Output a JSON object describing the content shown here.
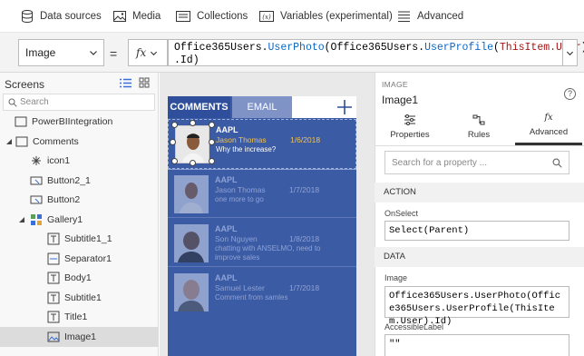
{
  "ribbon": {
    "items": [
      {
        "label": "Data sources",
        "icon": "database-icon"
      },
      {
        "label": "Media",
        "icon": "image-icon"
      },
      {
        "label": "Collections",
        "icon": "collection-icon"
      },
      {
        "label": "Variables (experimental)",
        "icon": "variable-icon"
      },
      {
        "label": "Advanced",
        "icon": "list-icon"
      }
    ]
  },
  "formula_bar": {
    "property": "Image",
    "equals": "=",
    "fx": "fx",
    "tokens": [
      {
        "t": "Office365Users.",
        "c": "plain"
      },
      {
        "t": "UserPhoto",
        "c": "fn"
      },
      {
        "t": "(Office365Users.",
        "c": "plain"
      },
      {
        "t": "UserProfile",
        "c": "fn"
      },
      {
        "t": "(",
        "c": "plain"
      },
      {
        "t": "ThisItem.User",
        "c": "pm"
      },
      {
        "t": ")",
        "c": "plain"
      },
      {
        "t": ".Id)",
        "c": "plain"
      }
    ]
  },
  "screens": {
    "title": "Screens",
    "search_placeholder": "Search",
    "tree": [
      {
        "label": "PowerBIIntegration",
        "icon": "screen-icon"
      },
      {
        "label": "Comments",
        "icon": "screen-icon"
      },
      {
        "label": "icon1",
        "icon": "icon-control-icon"
      },
      {
        "label": "Button2_1",
        "icon": "button-icon"
      },
      {
        "label": "Button2",
        "icon": "button-icon"
      },
      {
        "label": "Gallery1",
        "icon": "gallery-icon"
      },
      {
        "label": "Subtitle1_1",
        "icon": "label-icon"
      },
      {
        "label": "Separator1",
        "icon": "separator-icon"
      },
      {
        "label": "Body1",
        "icon": "label-icon"
      },
      {
        "label": "Subtitle1",
        "icon": "label-icon"
      },
      {
        "label": "Title1",
        "icon": "label-icon"
      },
      {
        "label": "Image1",
        "icon": "image-icon"
      }
    ]
  },
  "app": {
    "tab_comments": "COMMENTS",
    "tab_email": "EMAIL",
    "plus": "+",
    "cards": [
      {
        "title": "AAPL",
        "name": "Jason Thomas",
        "date": "1/6/2018",
        "body": "Why the increase?"
      },
      {
        "title": "AAPL",
        "name": "Jason Thomas",
        "date": "1/7/2018",
        "body": "one more to go"
      },
      {
        "title": "AAPL",
        "name": "Son Nguyen",
        "date": "1/8/2018",
        "body": "chatting with ANSELMO, need to improve sales"
      },
      {
        "title": "AAPL",
        "name": "Samuel Lester",
        "date": "1/7/2018",
        "body": "Comment from samles"
      }
    ]
  },
  "props": {
    "caption": "IMAGE",
    "name": "Image1",
    "help": "?",
    "tabs": [
      {
        "label": "Properties",
        "icon": "sliders-icon"
      },
      {
        "label": "Rules",
        "icon": "rules-icon"
      },
      {
        "label": "Advanced",
        "icon": "fx-icon"
      }
    ],
    "search_placeholder": "Search for a property ...",
    "sections": {
      "action": "ACTION",
      "data": "DATA"
    },
    "onselect_label": "OnSelect",
    "onselect_value": "Select(Parent)",
    "image_label": "Image",
    "image_value": "Office365Users.UserPhoto(Office365Users.UserProfile(ThisItem.User).Id)",
    "accessible_label": "AccessibleLabel",
    "accessible_value": "\"\""
  }
}
